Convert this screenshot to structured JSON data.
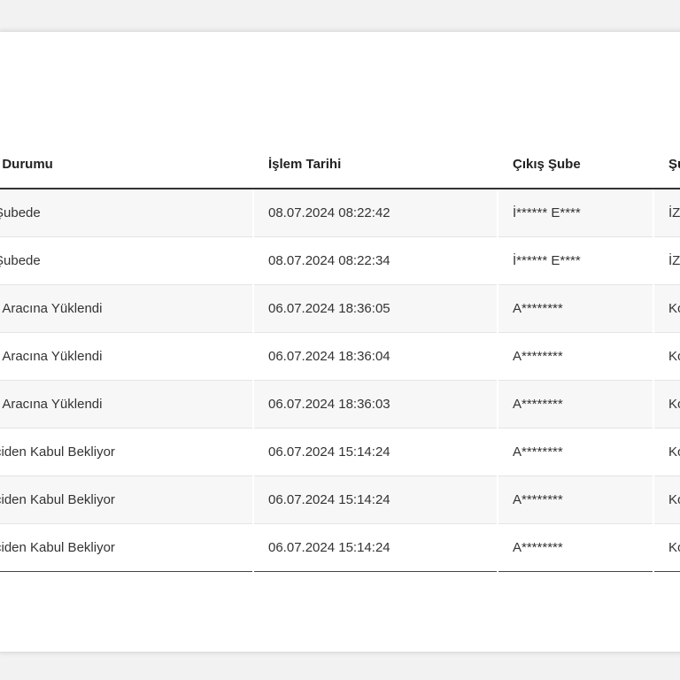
{
  "table": {
    "headers": [
      "i Durumu",
      "İşlem Tarihi",
      "Çıkış Şube",
      "Şu"
    ],
    "rows": [
      [
        "Şubede",
        "08.07.2024 08:22:42",
        "İ****** E****",
        "İZ"
      ],
      [
        "Şubede",
        "08.07.2024 08:22:34",
        "İ****** E****",
        "İZ"
      ],
      [
        "r Aracına Yüklendi",
        "06.07.2024 18:36:05",
        "A********",
        "Ko"
      ],
      [
        "r Aracına Yüklendi",
        "06.07.2024 18:36:04",
        "A********",
        "Ko"
      ],
      [
        "r Aracına Yüklendi",
        "06.07.2024 18:36:03",
        "A********",
        "Ko"
      ],
      [
        "ciden Kabul Bekliyor",
        "06.07.2024 15:14:24",
        "A********",
        "Ko"
      ],
      [
        "ciden Kabul Bekliyor",
        "06.07.2024 15:14:24",
        "A********",
        "Ko"
      ],
      [
        "ciden Kabul Bekliyor",
        "06.07.2024 15:14:24",
        "A********",
        "Ko"
      ]
    ]
  }
}
